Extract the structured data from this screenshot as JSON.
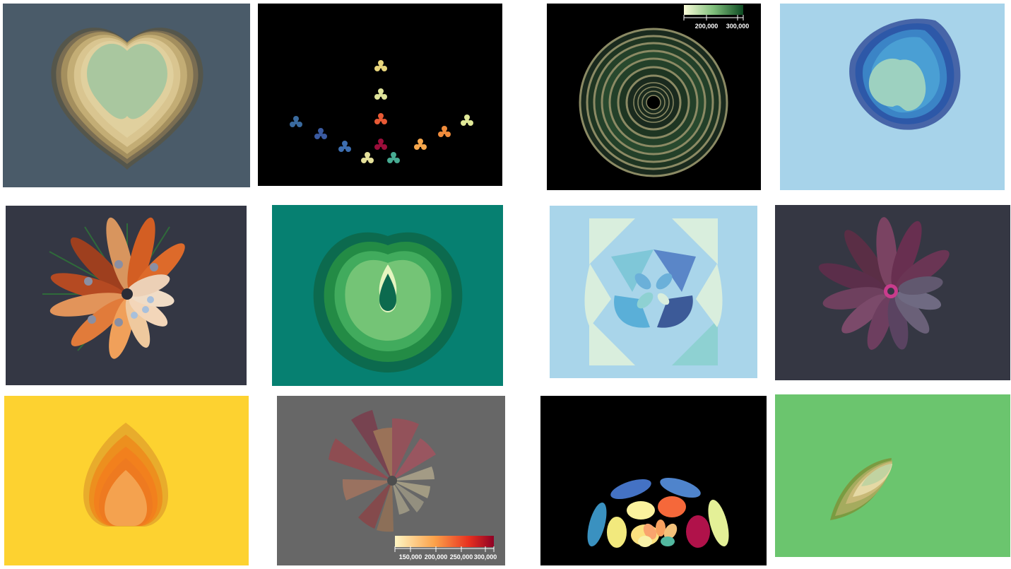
{
  "gallery": {
    "tiles": [
      {
        "name": "heart-tan",
        "background": "#4a5b69"
      },
      {
        "name": "trefoil-markers",
        "background": "#000000"
      },
      {
        "name": "concentric-rings",
        "background": "#000000",
        "legend_ticks": [
          "200,000",
          "300,000"
        ]
      },
      {
        "name": "blue-heart",
        "background": "#a7d3ea"
      },
      {
        "name": "orange-flower",
        "background": "#343744"
      },
      {
        "name": "green-heart",
        "background": "#068071"
      },
      {
        "name": "blue-kaleidoscope",
        "background": "#a9d5ea"
      },
      {
        "name": "purple-flower",
        "background": "#353743"
      },
      {
        "name": "orange-drop",
        "background": "#fdd230"
      },
      {
        "name": "radial-wedges",
        "background": "#676767",
        "legend_ticks": [
          "150,000",
          "200,000",
          "250,000",
          "300,000"
        ]
      },
      {
        "name": "ellipse-dome",
        "background": "#000000"
      },
      {
        "name": "green-leaf",
        "background": "#6bc56e"
      }
    ]
  }
}
